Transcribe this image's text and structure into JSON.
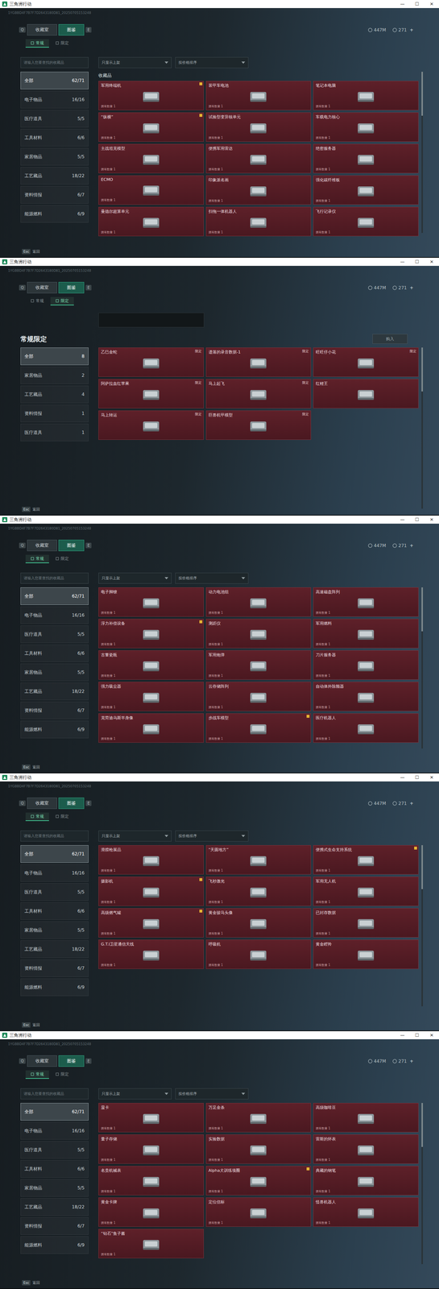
{
  "windows": [
    {
      "kind": "standard",
      "title": "三角洲行动",
      "controls": [
        "—",
        "☐",
        "✕"
      ],
      "idText": "1YGBBD4F7B7F7D2643180D81_20250705153248",
      "nav": {
        "prevKey": "Q",
        "nextKey": "E",
        "tabs": [
          {
            "label": "收藏室",
            "selected": false
          },
          {
            "label": "图鉴",
            "selected": true
          }
        ]
      },
      "subtabs": [
        {
          "label": "常规",
          "selected": true
        },
        {
          "label": "限定",
          "selected": false
        }
      ],
      "currency": [
        {
          "value": "447M"
        },
        {
          "value": "271",
          "plus": "+"
        }
      ],
      "search": {
        "placeholder": "请输入您要查找的收藏品"
      },
      "filters": [
        "只显示上架",
        "按价格排序"
      ],
      "sidebar": [
        {
          "label": "全部",
          "count": "62/71",
          "selected": true
        },
        {
          "label": "电子物品",
          "count": "16/16",
          "selected": false
        },
        {
          "label": "医疗道具",
          "count": "5/5",
          "selected": false
        },
        {
          "label": "工具材料",
          "count": "6/6",
          "selected": false
        },
        {
          "label": "家居物品",
          "count": "5/5",
          "selected": false
        },
        {
          "label": "工艺藏品",
          "count": "18/22",
          "selected": false
        },
        {
          "label": "资料情报",
          "count": "6/7",
          "selected": false
        },
        {
          "label": "能源燃料",
          "count": "6/9",
          "selected": false
        }
      ],
      "gridTitle": "收藏品",
      "cardNote": "拥有数量 1",
      "items": [
        {
          "name": "军用终端机",
          "badge": true
        },
        {
          "name": "装甲车电池",
          "badge": false
        },
        {
          "name": "笔记本电脑",
          "badge": false
        },
        {
          "name": "“纵横”",
          "badge": true
        },
        {
          "name": "试验型变异核单元",
          "badge": false
        },
        {
          "name": "车载电力核心",
          "badge": false
        },
        {
          "name": "主战坦克模型",
          "badge": false
        },
        {
          "name": "便携军用雷达",
          "badge": false
        },
        {
          "name": "绝密服务器",
          "badge": false
        },
        {
          "name": "ECMO",
          "badge": false
        },
        {
          "name": "印象派名画",
          "badge": false
        },
        {
          "name": "强化碳纤维板",
          "badge": false
        },
        {
          "name": "曼德尔超算单元",
          "badge": false
        },
        {
          "name": "扫拖一体机器人",
          "badge": false
        },
        {
          "name": "飞行记录仪",
          "badge": false
        }
      ],
      "footer": {
        "key": "Esc",
        "label": "返回"
      }
    },
    {
      "kind": "limited",
      "title": "三角洲行动",
      "controls": [
        "—",
        "☐",
        "✕"
      ],
      "idText": "1YGBBD4F7B7F7D2643180D81_20250705153248",
      "nav": {
        "prevKey": "Q",
        "nextKey": "E",
        "tabs": [
          {
            "label": "收藏室",
            "selected": false
          },
          {
            "label": "图鉴",
            "selected": true
          }
        ]
      },
      "subtabs": [
        {
          "label": "常规",
          "selected": false
        },
        {
          "label": "限定",
          "selected": true
        }
      ],
      "currency": [
        {
          "value": "447M"
        },
        {
          "value": "271",
          "plus": "+"
        }
      ],
      "heading": "常规限定",
      "actionButton": "购入",
      "limitedLabel": "限定",
      "sidebar": [
        {
          "label": "全部",
          "count": "8",
          "selected": true
        },
        {
          "label": "家居物品",
          "count": "2",
          "selected": false
        },
        {
          "label": "工艺藏品",
          "count": "4",
          "selected": false
        },
        {
          "label": "资料情报",
          "count": "1",
          "selected": false
        },
        {
          "label": "医疗道具",
          "count": "1",
          "selected": false
        }
      ],
      "items": [
        {
          "name": "乙巳金蛇",
          "limited": true
        },
        {
          "name": "遗落的录音数据-1",
          "limited": true
        },
        {
          "name": "旺旺仔小花",
          "limited": true
        },
        {
          "name": "阿萨拉血红苹果",
          "limited": true
        },
        {
          "name": "马上起飞",
          "limited": true
        },
        {
          "name": "红鲤王",
          "limited": false
        },
        {
          "name": "马上转运",
          "limited": true
        },
        {
          "name": "巨兽机甲模型",
          "limited": true
        }
      ],
      "footer": {
        "key": "Esc",
        "label": "返回"
      }
    },
    {
      "kind": "standard",
      "title": "三角洲行动",
      "controls": [
        "—",
        "☐",
        "✕"
      ],
      "idText": "1YGBBD4F7B7F7D2643180D81_20250705153248",
      "nav": {
        "prevKey": "Q",
        "nextKey": "E",
        "tabs": [
          {
            "label": "收藏室",
            "selected": false
          },
          {
            "label": "图鉴",
            "selected": true
          }
        ]
      },
      "subtabs": [
        {
          "label": "常规",
          "selected": true
        },
        {
          "label": "限定",
          "selected": false
        }
      ],
      "currency": [
        {
          "value": "447M"
        },
        {
          "value": "271",
          "plus": "+"
        }
      ],
      "search": {
        "placeholder": "请输入您要查找的收藏品"
      },
      "filters": [
        "只显示上架",
        "按价格排序"
      ],
      "sidebar": [
        {
          "label": "全部",
          "count": "62/71",
          "selected": true
        },
        {
          "label": "电子物品",
          "count": "16/16",
          "selected": false
        },
        {
          "label": "医疗道具",
          "count": "5/5",
          "selected": false
        },
        {
          "label": "工具材料",
          "count": "6/6",
          "selected": false
        },
        {
          "label": "家居物品",
          "count": "5/5",
          "selected": false
        },
        {
          "label": "工艺藏品",
          "count": "18/22",
          "selected": false
        },
        {
          "label": "资料情报",
          "count": "6/7",
          "selected": false
        },
        {
          "label": "能源燃料",
          "count": "6/9",
          "selected": false
        }
      ],
      "gridTitle": "",
      "cardNote": "拥有数量 1",
      "items": [
        {
          "name": "电子脚镣",
          "badge": false
        },
        {
          "name": "动力电池组",
          "badge": false
        },
        {
          "name": "高速磁盘阵列",
          "badge": false
        },
        {
          "name": "浮力补偿设备",
          "badge": true
        },
        {
          "name": "测距仪",
          "badge": false
        },
        {
          "name": "军用燃料",
          "badge": false
        },
        {
          "name": "古董瓷瓶",
          "badge": false
        },
        {
          "name": "军用炮弹",
          "badge": false
        },
        {
          "name": "刀片服务器",
          "badge": false
        },
        {
          "name": "强力吸尘器",
          "badge": false
        },
        {
          "name": "云存储阵列",
          "badge": false
        },
        {
          "name": "自动体外除颤器",
          "badge": false
        },
        {
          "name": "克劳迪乌斯半身像",
          "badge": false
        },
        {
          "name": "步战车模型",
          "badge": true
        },
        {
          "name": "医疗机器人",
          "badge": false
        }
      ],
      "footer": {
        "key": "Esc",
        "label": "返回"
      }
    },
    {
      "kind": "standard",
      "title": "三角洲行动",
      "controls": [
        "—",
        "☐",
        "✕"
      ],
      "idText": "1YGBBD4F7B7F7D2643180D81_20250705153248",
      "nav": {
        "prevKey": "Q",
        "nextKey": "E",
        "tabs": [
          {
            "label": "收藏室",
            "selected": false
          },
          {
            "label": "图鉴",
            "selected": true
          }
        ]
      },
      "subtabs": [
        {
          "label": "常规",
          "selected": true
        },
        {
          "label": "限定",
          "selected": false
        }
      ],
      "currency": [
        {
          "value": "447M"
        },
        {
          "value": "271",
          "plus": "+"
        }
      ],
      "search": {
        "placeholder": "请输入您要查找的收藏品"
      },
      "filters": [
        "只显示上架",
        "按价格排序"
      ],
      "sidebar": [
        {
          "label": "全部",
          "count": "62/71",
          "selected": true
        },
        {
          "label": "电子物品",
          "count": "16/16",
          "selected": false
        },
        {
          "label": "医疗道具",
          "count": "5/5",
          "selected": false
        },
        {
          "label": "工具材料",
          "count": "6/6",
          "selected": false
        },
        {
          "label": "家居物品",
          "count": "5/5",
          "selected": false
        },
        {
          "label": "工艺藏品",
          "count": "18/22",
          "selected": false
        },
        {
          "label": "资料情报",
          "count": "6/7",
          "selected": false
        },
        {
          "label": "能源燃料",
          "count": "6/9",
          "selected": false
        }
      ],
      "gridTitle": "",
      "cardNote": "拥有数量 1",
      "items": [
        {
          "name": "滑膛枪展品",
          "badge": false
        },
        {
          "name": "“天圆地方”",
          "badge": false
        },
        {
          "name": "便携式生命支持系统",
          "badge": true
        },
        {
          "name": "摄影机",
          "badge": true
        },
        {
          "name": "飞秒激光",
          "badge": false
        },
        {
          "name": "军用无人机",
          "badge": false
        },
        {
          "name": "高级燃气罐",
          "badge": true
        },
        {
          "name": "黄金骏马头像",
          "badge": false
        },
        {
          "name": "已封存数据",
          "badge": false
        },
        {
          "name": "G.T.I卫星通信天线",
          "badge": false
        },
        {
          "name": "呼吸机",
          "badge": false
        },
        {
          "name": "黄金瞪羚",
          "badge": false
        }
      ],
      "footer": {
        "key": "Esc",
        "label": "返回"
      }
    },
    {
      "kind": "standard",
      "title": "三角洲行动",
      "controls": [
        "—",
        "☐",
        "✕"
      ],
      "idText": "1YGBBD4F7B7F7D2643180D81_20250705153248",
      "nav": {
        "prevKey": "Q",
        "nextKey": "E",
        "tabs": [
          {
            "label": "收藏室",
            "selected": false
          },
          {
            "label": "图鉴",
            "selected": true
          }
        ]
      },
      "subtabs": [
        {
          "label": "常规",
          "selected": true
        },
        {
          "label": "限定",
          "selected": false
        }
      ],
      "currency": [
        {
          "value": "447M"
        },
        {
          "value": "271",
          "plus": "+"
        }
      ],
      "search": {
        "placeholder": "请输入您要查找的收藏品"
      },
      "filters": [
        "只显示上架",
        "按价格排序"
      ],
      "sidebar": [
        {
          "label": "全部",
          "count": "62/71",
          "selected": true
        },
        {
          "label": "电子物品",
          "count": "16/16",
          "selected": false
        },
        {
          "label": "医疗道具",
          "count": "5/5",
          "selected": false
        },
        {
          "label": "工具材料",
          "count": "6/6",
          "selected": false
        },
        {
          "label": "家居物品",
          "count": "5/5",
          "selected": false
        },
        {
          "label": "工艺藏品",
          "count": "18/22",
          "selected": false
        },
        {
          "label": "资料情报",
          "count": "6/7",
          "selected": false
        },
        {
          "label": "能源燃料",
          "count": "6/9",
          "selected": false
        }
      ],
      "gridTitle": "",
      "cardNote": "拥有数量 1",
      "items": [
        {
          "name": "显卡",
          "badge": false
        },
        {
          "name": "万足金条",
          "badge": false
        },
        {
          "name": "高级咖啡豆",
          "badge": false
        },
        {
          "name": "量子存储",
          "badge": false
        },
        {
          "name": "实验数据",
          "badge": false
        },
        {
          "name": "雷斯的怀表",
          "badge": false
        },
        {
          "name": "名贵机械表",
          "badge": false
        },
        {
          "name": "Alpha犬训练项圈",
          "badge": true
        },
        {
          "name": "典藏的钢笔",
          "badge": false
        },
        {
          "name": "黄金卡牌",
          "badge": false
        },
        {
          "name": "定位信标",
          "badge": false
        },
        {
          "name": "怪兽机器人",
          "badge": false
        },
        {
          "name": "“钻石”鱼子酱",
          "badge": false
        }
      ],
      "footer": {
        "key": "Esc",
        "label": "返回"
      }
    }
  ]
}
